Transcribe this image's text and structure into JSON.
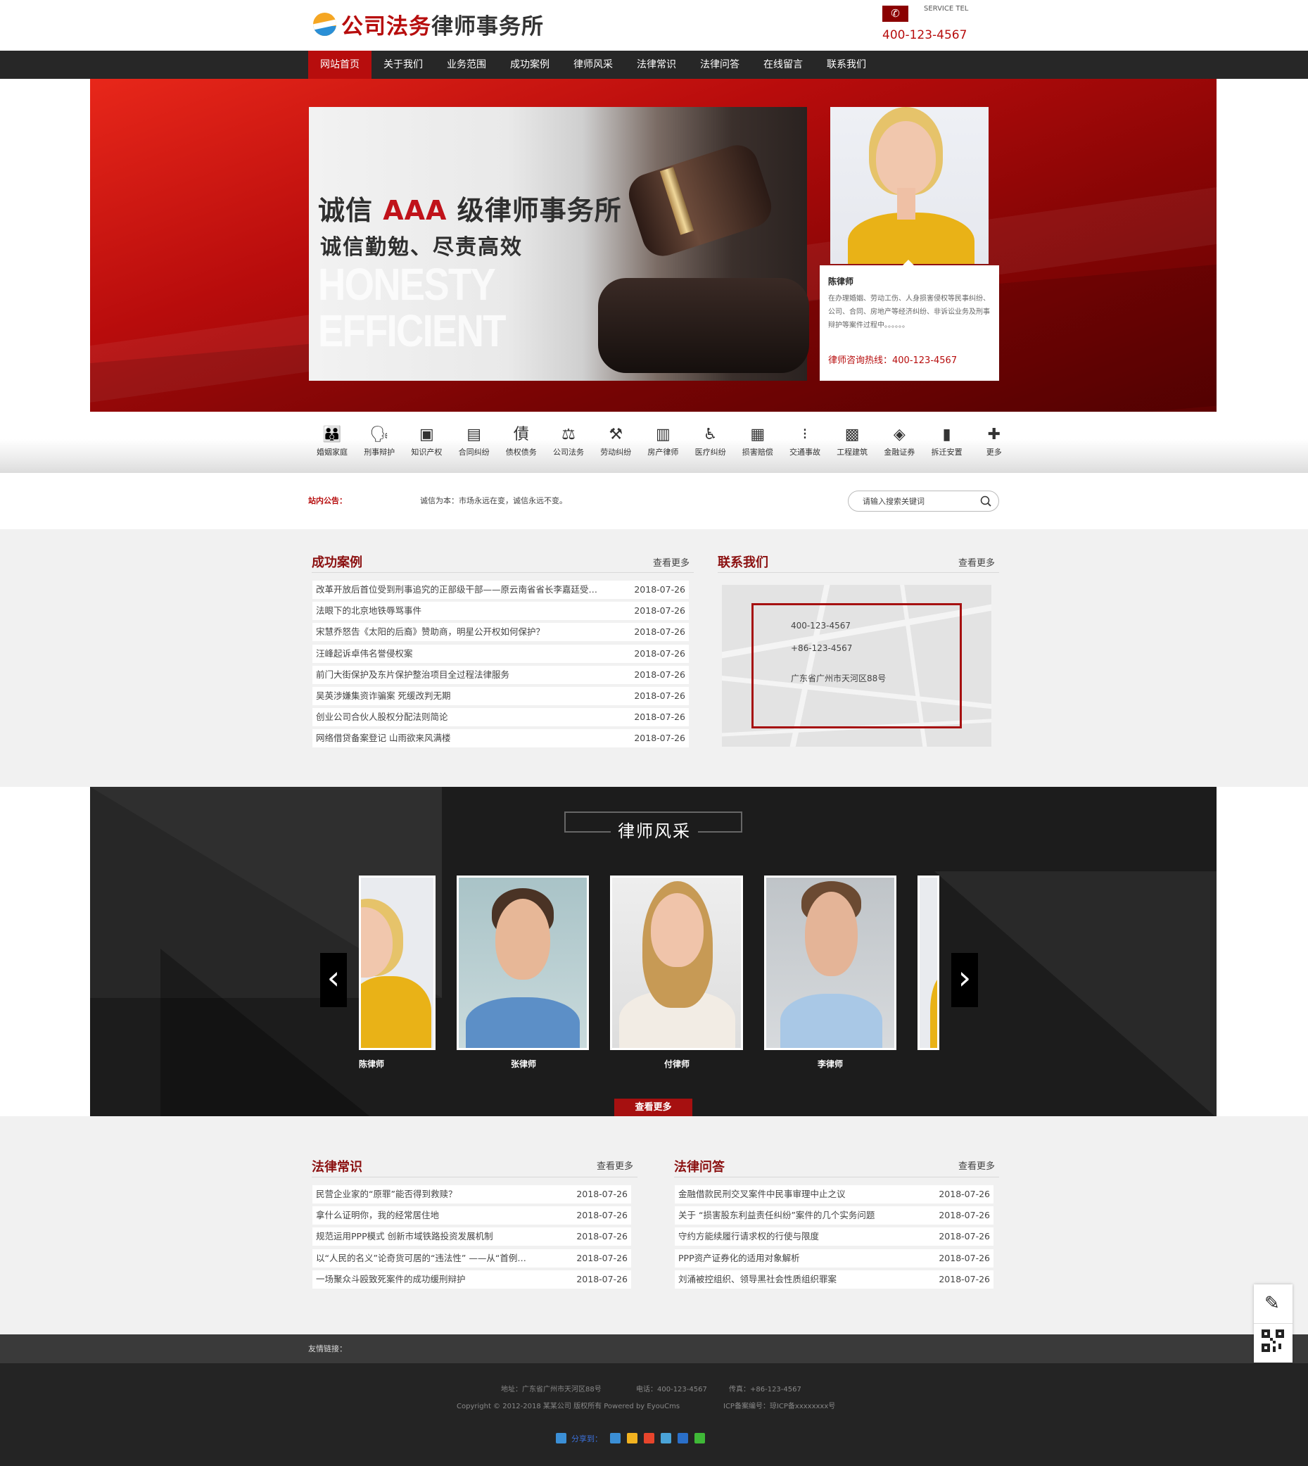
{
  "header": {
    "logo_text_red": "公司法务",
    "logo_text_dark": "律师事务所",
    "service_label": "SERVICE TEL",
    "hotline": "400-123-4567",
    "phone_icon": "phone-icon"
  },
  "nav": {
    "items": [
      "网站首页",
      "关于我们",
      "业务范围",
      "成功案例",
      "律师风采",
      "法律常识",
      "法律问答",
      "在线留言",
      "联系我们"
    ],
    "active_index": 0
  },
  "banner": {
    "headline_pre": "诚信 ",
    "headline_accent": "AAA",
    "headline_post": " 级律师事务所",
    "subline": "诚信勤勉、尽责高效",
    "en_line1": "HONESTY",
    "en_line2": "EFFICIENT",
    "lawyer_name": "陈律师",
    "lawyer_desc": "在办理婚姻、劳动工伤、人身损害侵权等民事纠纷、公司、合同、房地产等经济纠纷、非诉讼业务及刑事辩护等案件过程中。。。。。。",
    "lawyer_hotline": "律师咨询热线：400-123-4567"
  },
  "categories": [
    {
      "label": "婚姻家庭",
      "icon": "family-icon"
    },
    {
      "label": "刑事辩护",
      "icon": "speaking-head-icon"
    },
    {
      "label": "知识产权",
      "icon": "film-frame-icon"
    },
    {
      "label": "合同纠纷",
      "icon": "document-icon"
    },
    {
      "label": "债权债务",
      "icon": "debt-icon"
    },
    {
      "label": "公司法务",
      "icon": "scales-icon"
    },
    {
      "label": "劳动纠纷",
      "icon": "worker-icon"
    },
    {
      "label": "房产律师",
      "icon": "building-icon"
    },
    {
      "label": "医疗纠纷",
      "icon": "wheelchair-icon"
    },
    {
      "label": "损害赔偿",
      "icon": "certificate-icon"
    },
    {
      "label": "交通事故",
      "icon": "traffic-light-icon"
    },
    {
      "label": "工程建筑",
      "icon": "brick-wall-icon"
    },
    {
      "label": "金融证券",
      "icon": "coin-icon"
    },
    {
      "label": "拆迁安置",
      "icon": "city-icon"
    },
    {
      "label": "更多",
      "icon": "plus-icon"
    }
  ],
  "notice": {
    "label": "站内公告：",
    "text": "诚信为本：市场永远在变，诚信永远不变。",
    "search_placeholder": "请输入搜索关键词"
  },
  "cases": {
    "title": "成功案例",
    "more": "查看更多",
    "rows": [
      {
        "title": "改革开放后首位受到刑事追究的正部级干部——原云南省省长李嘉廷受…",
        "date": "2018-07-26"
      },
      {
        "title": "法眼下的北京地铁辱骂事件",
        "date": "2018-07-26"
      },
      {
        "title": "宋慧乔怒告《太阳的后裔》赞助商，明星公开权如何保护？",
        "date": "2018-07-26"
      },
      {
        "title": "汪峰起诉卓伟名誉侵权案",
        "date": "2018-07-26"
      },
      {
        "title": "前门大街保护及东片保护整治项目全过程法律服务",
        "date": "2018-07-26"
      },
      {
        "title": "吴英涉嫌集资诈骗案 死缓改判无期",
        "date": "2018-07-26"
      },
      {
        "title": "创业公司合伙人股权分配法则简论",
        "date": "2018-07-26"
      },
      {
        "title": "网络借贷备案登记 山雨欲来风满楼",
        "date": "2018-07-26"
      }
    ]
  },
  "contact": {
    "title": "联系我们",
    "more": "查看更多",
    "phone": "400-123-4567",
    "fax": "+86-123-4567",
    "address": "广东省广州市天河区88号"
  },
  "team": {
    "title": "律师风采",
    "members": [
      "陈律师",
      "张律师",
      "付律师",
      "李律师"
    ],
    "prev_icon": "chevron-left-icon",
    "next_icon": "chevron-right-icon",
    "more": "查看更多"
  },
  "knowledge": {
    "title": "法律常识",
    "more": "查看更多",
    "rows": [
      {
        "title": "民营企业家的“原罪”能否得到救赎？",
        "date": "2018-07-26"
      },
      {
        "title": "拿什么证明你，我的经常居住地",
        "date": "2018-07-26"
      },
      {
        "title": "规范运用PPP模式 创新市域铁路投资发展机制",
        "date": "2018-07-26"
      },
      {
        "title": "以“人民的名义”论奇货可居的“违法性” ——从“首例…",
        "date": "2018-07-26"
      },
      {
        "title": "一场聚众斗殴致死案件的成功缓刑辩护",
        "date": "2018-07-26"
      }
    ]
  },
  "qa": {
    "title": "法律问答",
    "more": "查看更多",
    "rows": [
      {
        "title": "金融借款民刑交叉案件中民事审理中止之议",
        "date": "2018-07-26"
      },
      {
        "title": "关于 “损害股东利益责任纠纷”案件的几个实务问题",
        "date": "2018-07-26"
      },
      {
        "title": "守约方能续履行请求权的行使与限度",
        "date": "2018-07-26"
      },
      {
        "title": "PPP资产证券化的适用对象解析",
        "date": "2018-07-26"
      },
      {
        "title": "刘涌被控组织、领导黑社会性质组织罪案",
        "date": "2018-07-26"
      }
    ]
  },
  "footer": {
    "links_label": "友情链接：",
    "address": "地址：广东省广州市天河区88号",
    "tel": "电话：400-123-4567",
    "fax": "传真：+86-123-4567",
    "copyright": "Copyright © 2012-2018 某某公司 版权所有 Powered by EyouCms",
    "icp": "ICP备案编号：琼ICP备xxxxxxxx号",
    "share_label": "分享到：",
    "share_icons": [
      "share-more-icon",
      "qzone-icon",
      "weibo-icon",
      "tencent-weibo-icon",
      "renren-icon",
      "wechat-icon"
    ]
  },
  "side": {
    "feedback_icon": "edit-icon",
    "qr_icon": "qr-code-icon"
  },
  "colors": {
    "brand_red": "#b70d0d",
    "nav_bg": "#272727",
    "section_title": "#8b1010"
  }
}
